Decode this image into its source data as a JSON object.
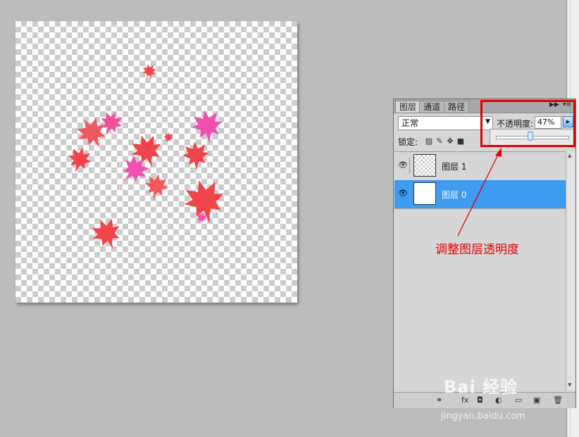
{
  "canvas": {
    "leaf_colors": {
      "red": "#f0444a",
      "pink": "#f050b0",
      "coral": "#f4585c"
    }
  },
  "layers_panel": {
    "tabs": [
      "图层",
      "通道",
      "路径"
    ],
    "blend_mode": "正常",
    "opacity_label": "不透明度:",
    "opacity_value": "47%",
    "opacity_percent": 47,
    "lock_label": "锁定:",
    "fill_value": "%",
    "layers": [
      {
        "name": "图层 1",
        "visible": true,
        "selected": false,
        "thumbnail": "transparent-checker"
      },
      {
        "name": "图层 0",
        "visible": true,
        "selected": true,
        "thumbnail": "white"
      }
    ]
  },
  "annotation": {
    "text": "调整图层透明度",
    "color": "#e00000"
  },
  "watermark": {
    "logo": "Bai 经验",
    "url": "jingyan.baidu.com"
  }
}
